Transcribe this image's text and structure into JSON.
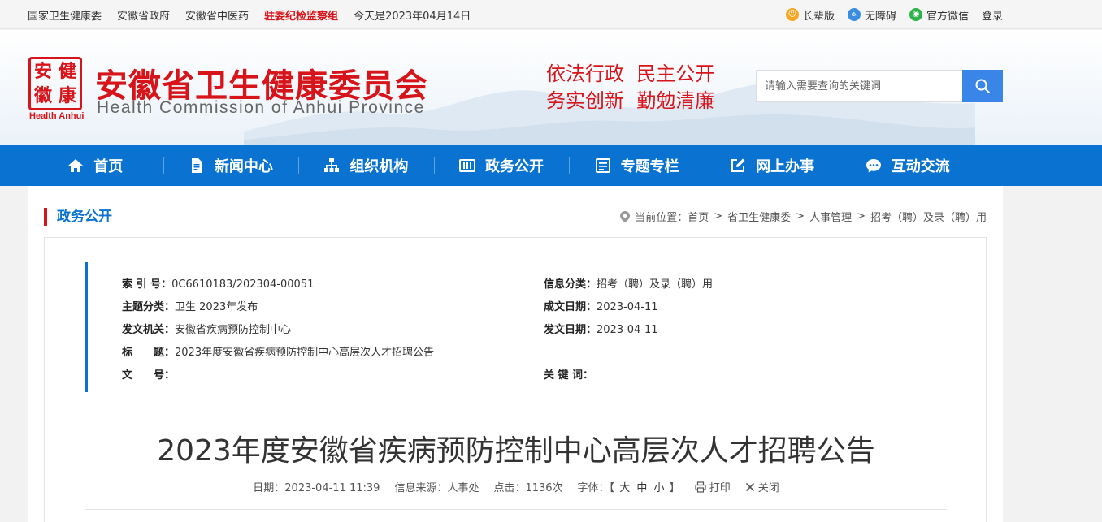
{
  "topbar": {
    "links": [
      "国家卫生健康委",
      "安徽省政府",
      "安徽省中医药"
    ],
    "highlight": "驻委纪检监察组",
    "date": "今天是2023年04月14日",
    "tools": [
      {
        "icon": "elder-icon",
        "label": "长辈版"
      },
      {
        "icon": "accessibility-icon",
        "label": "无障碍"
      },
      {
        "icon": "wechat-icon",
        "label": "官方微信"
      }
    ],
    "login": "登录"
  },
  "header": {
    "logo_chars": [
      "安",
      "健",
      "徽",
      "康"
    ],
    "logo_sub": "Health Anhui",
    "title": "安徽省卫生健康委员会",
    "title_en": "Health Commission of Anhui Province",
    "slogan_line1": "依法行政  民主公开",
    "slogan_line2": "务实创新  勤勉清廉",
    "search_placeholder": "请输入需要查询的关键词",
    "brand_red": "#d7141a",
    "brand_blue": "#0a72d0"
  },
  "nav": {
    "items": [
      {
        "icon": "home-icon",
        "label": "首页"
      },
      {
        "icon": "document-icon",
        "label": "新闻中心"
      },
      {
        "icon": "org-chart-icon",
        "label": "组织机构"
      },
      {
        "icon": "government-icon",
        "label": "政务公开"
      },
      {
        "icon": "topic-icon",
        "label": "专题专栏"
      },
      {
        "icon": "edit-icon",
        "label": "网上办事"
      },
      {
        "icon": "chat-icon",
        "label": "互动交流"
      }
    ]
  },
  "section": {
    "title": "政务公开",
    "breadcrumb_prefix": "当前位置：",
    "breadcrumb": [
      "首页",
      "省卫生健康委",
      "人事管理",
      "招考（聘）及录（聘）用"
    ]
  },
  "meta": {
    "index_label": "索 引 号：",
    "index_value": "0C6610183/202304-00051",
    "category_label": "信息分类：",
    "category_value": "招考（聘）及录（聘）用",
    "topic_label": "主题分类：",
    "topic_value": "卫生 2023年发布",
    "created_label": "成文日期：",
    "created_value": "2023-04-11",
    "issuer_label": "发文机关：",
    "issuer_value": "安徽省疾病预防控制中心",
    "published_label": "发文日期：",
    "published_value": "2023-04-11",
    "title_label": "标　　题：",
    "title_value": "2023年度安徽省疾病预防控制中心高层次人才招聘公告",
    "docno_label": "文　　号：",
    "docno_value": "",
    "keywords_label": "关 键 词：",
    "keywords_value": ""
  },
  "article": {
    "title": "2023年度安徽省疾病预防控制中心高层次人才招聘公告",
    "date": "日期：2023-04-11 11:39",
    "source": "信息来源：人事处",
    "clicks": "点击：1136次",
    "font_label": "字体：【",
    "font_large": "大",
    "font_medium": "中",
    "font_small": "小",
    "font_end": "】",
    "print": "打印",
    "close": "关闭"
  }
}
